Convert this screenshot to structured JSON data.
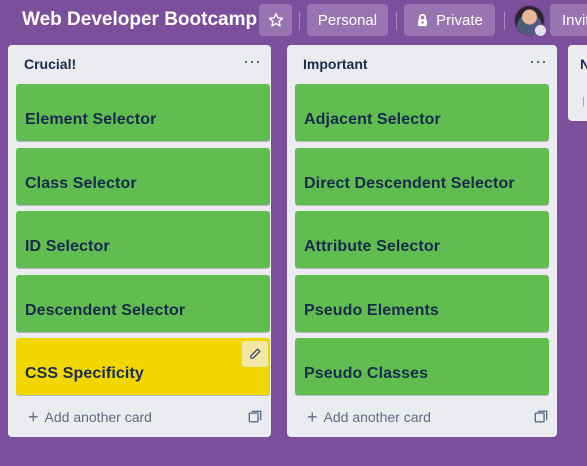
{
  "header": {
    "board_title": "Web Developer Bootcamp",
    "personal_label": "Personal",
    "private_label": "Private",
    "invite_label": "Invite"
  },
  "lists": [
    {
      "title": "Crucial!",
      "cards": [
        {
          "title": "Element Selector",
          "color": "#61bd4f"
        },
        {
          "title": "Class Selector",
          "color": "#61bd4f"
        },
        {
          "title": "ID Selector",
          "color": "#61bd4f"
        },
        {
          "title": "Descendent Selector",
          "color": "#61bd4f"
        },
        {
          "title": "CSS Specificity",
          "color": "#f2d600"
        }
      ],
      "add_label": "Add another card"
    },
    {
      "title": "Important",
      "cards": [
        {
          "title": "Adjacent Selector",
          "color": "#61bd4f"
        },
        {
          "title": "Direct Descendent Selector",
          "color": "#61bd4f"
        },
        {
          "title": "Attribute Selector",
          "color": "#61bd4f"
        },
        {
          "title": "Pseudo Elements",
          "color": "#61bd4f"
        },
        {
          "title": "Pseudo Classes",
          "color": "#61bd4f"
        }
      ],
      "add_label": "Add another card"
    },
    {
      "title": "N"
    }
  ],
  "colors": {
    "board_background": "#7b4f9c",
    "list_background": "#ebecf0",
    "label_green": "#61bd4f",
    "label_yellow": "#f2d600"
  },
  "icons": {
    "star": "star-icon",
    "lock": "lock-icon",
    "menu": "ellipsis-icon",
    "plus": "plus-icon",
    "template": "card-template-icon",
    "edit": "pencil-icon"
  }
}
